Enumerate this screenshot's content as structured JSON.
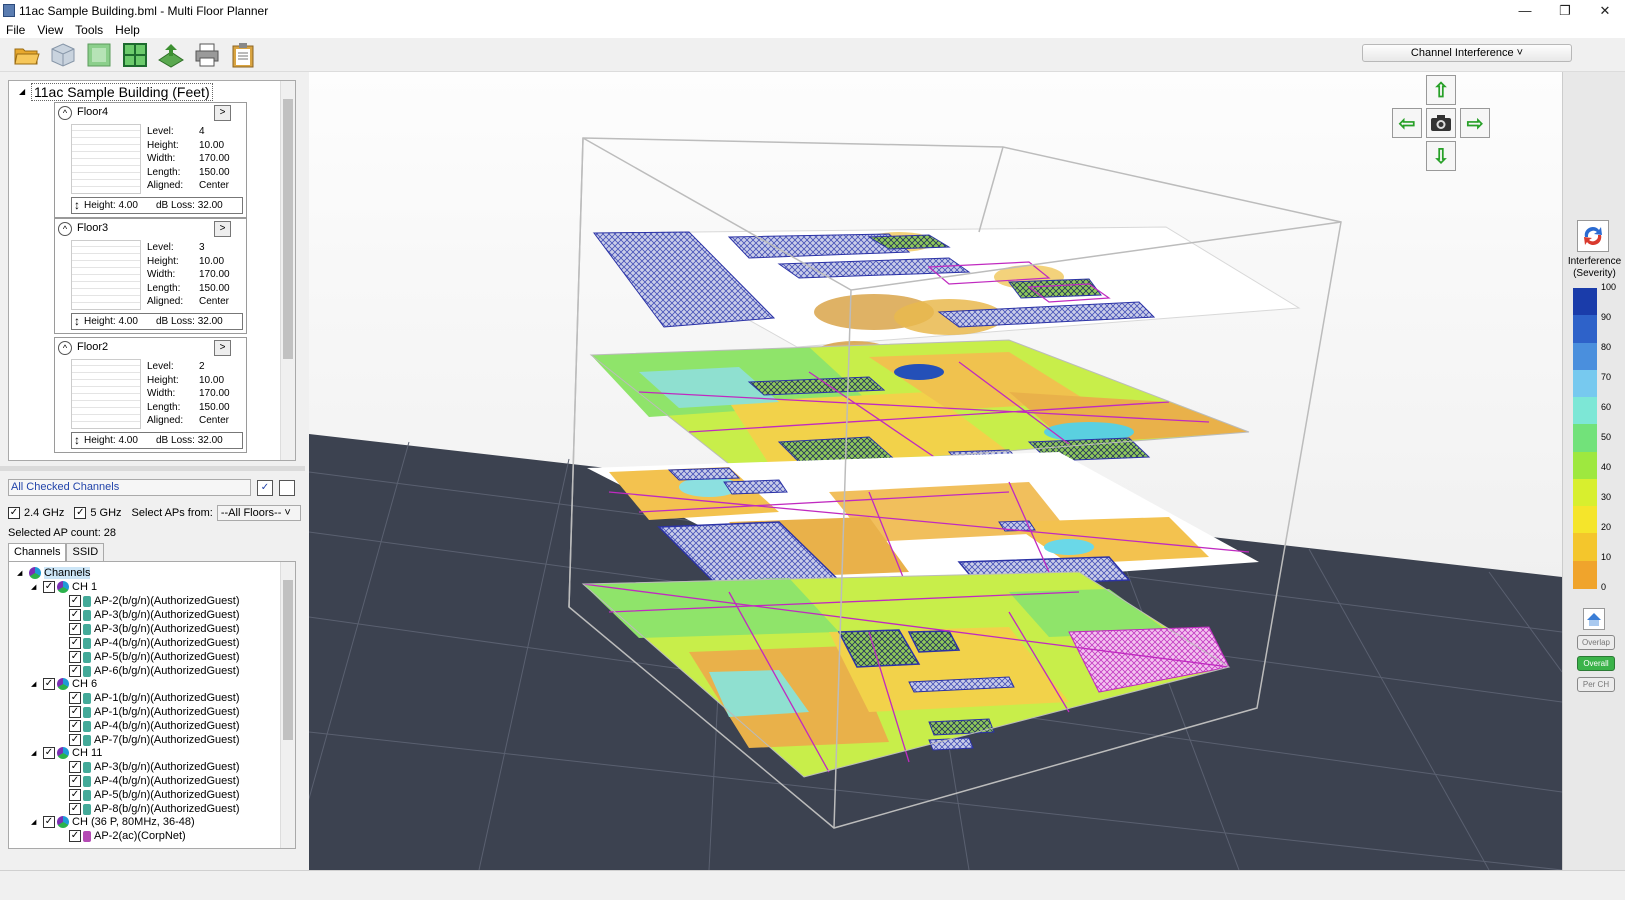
{
  "window": {
    "title": "11ac Sample Building.bml - Multi Floor Planner",
    "minimize": "—",
    "restore": "❐",
    "close": "✕"
  },
  "menu": [
    "File",
    "View",
    "Tools",
    "Help"
  ],
  "toolbar": {
    "icons": [
      "open-folder-icon",
      "cube-3d-icon",
      "floor-plan-icon",
      "grid-layout-icon",
      "export-icon",
      "print-icon",
      "clipboard-icon"
    ],
    "view_mode": "Channel Interference ˅"
  },
  "building": {
    "name": "11ac Sample Building (Feet)",
    "floors": [
      {
        "name": "Floor4",
        "level": "4",
        "height": "10.00",
        "width": "170.00",
        "length": "150.00",
        "aligned": "Center",
        "gap_height": "Height: 4.00",
        "db_loss": "dB Loss: 32.00"
      },
      {
        "name": "Floor3",
        "level": "3",
        "height": "10.00",
        "width": "170.00",
        "length": "150.00",
        "aligned": "Center",
        "gap_height": "Height: 4.00",
        "db_loss": "dB Loss: 32.00"
      },
      {
        "name": "Floor2",
        "level": "2",
        "height": "10.00",
        "width": "170.00",
        "length": "150.00",
        "aligned": "Center",
        "gap_height": "Height: 4.00",
        "db_loss": "dB Loss: 32.00"
      }
    ],
    "labels": {
      "level": "Level:",
      "height": "Height:",
      "width": "Width:",
      "length": "Length:",
      "aligned": "Aligned:"
    }
  },
  "filter": {
    "channels_label": "All Checked Channels",
    "band_24": "2.4 GHz",
    "band_5": "5 GHz",
    "select_aps_label": "Select APs from:",
    "select_aps_value": "--All Floors--",
    "ap_count": "Selected AP count: 28"
  },
  "tabs": [
    "Channels",
    "SSID"
  ],
  "channel_tree": {
    "root": "Channels",
    "groups": [
      {
        "label": "CH 1",
        "aps": [
          "AP-2(b/g/n)(AuthorizedGuest)",
          "AP-3(b/g/n)(AuthorizedGuest)",
          "AP-3(b/g/n)(AuthorizedGuest)",
          "AP-4(b/g/n)(AuthorizedGuest)",
          "AP-5(b/g/n)(AuthorizedGuest)",
          "AP-6(b/g/n)(AuthorizedGuest)"
        ]
      },
      {
        "label": "CH 6",
        "aps": [
          "AP-1(b/g/n)(AuthorizedGuest)",
          "AP-1(b/g/n)(AuthorizedGuest)",
          "AP-4(b/g/n)(AuthorizedGuest)",
          "AP-7(b/g/n)(AuthorizedGuest)"
        ]
      },
      {
        "label": "CH 11",
        "aps": [
          "AP-3(b/g/n)(AuthorizedGuest)",
          "AP-4(b/g/n)(AuthorizedGuest)",
          "AP-5(b/g/n)(AuthorizedGuest)",
          "AP-8(b/g/n)(AuthorizedGuest)"
        ]
      },
      {
        "label": "CH (36 P, 80MHz, 36-48)",
        "aps": [
          "AP-2(ac)(CorpNet)"
        ]
      }
    ]
  },
  "legend": {
    "title_line1": "Interference",
    "title_line2": "(Severity)",
    "ticks": [
      "100",
      "90",
      "80",
      "70",
      "60",
      "50",
      "40",
      "30",
      "20",
      "10",
      "0"
    ],
    "buttons": [
      "Overlap",
      "Overall",
      "Per CH"
    ],
    "active_button": "Overall",
    "colors": [
      "#1a3caa",
      "#2e62c9",
      "#4a8fdd",
      "#77c9ef",
      "#7de7d6",
      "#72e27a",
      "#9ee83f",
      "#d8ef2e",
      "#f5e52b",
      "#f4c62c",
      "#f0a42c"
    ]
  },
  "nav": {
    "up": "⇧",
    "down": "⇩",
    "left": "⇦",
    "right": "⇨",
    "camera": "camera-icon"
  }
}
